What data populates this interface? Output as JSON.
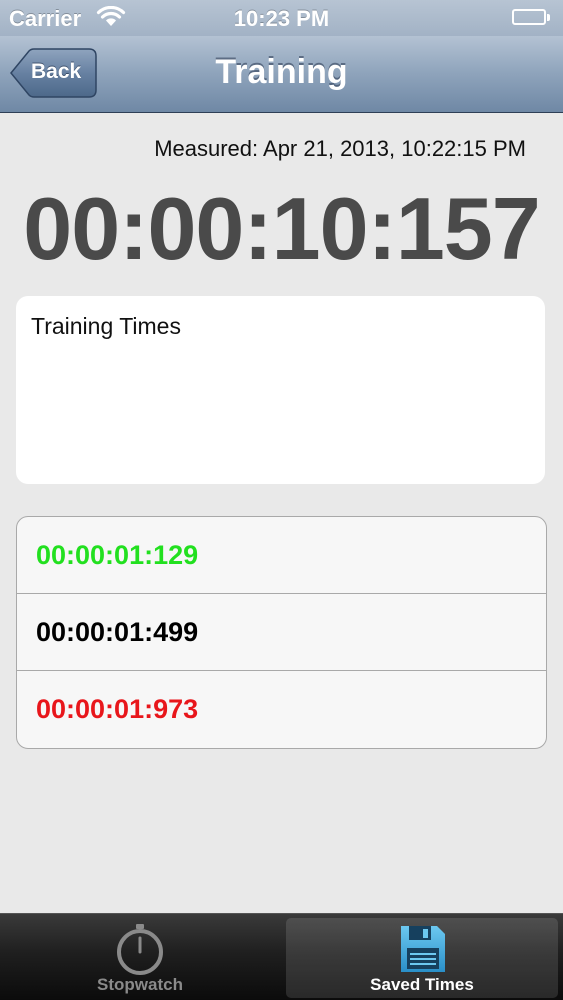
{
  "status_bar": {
    "carrier": "Carrier",
    "time": "10:23 PM",
    "battery_level": 1.0
  },
  "nav": {
    "back_label": "Back",
    "title": "Training"
  },
  "measured_label": "Measured: Apr 21, 2013, 10:22:15 PM",
  "total_time": "00:00:10:157",
  "notes": {
    "text": "Training Times"
  },
  "times": [
    {
      "value": "00:00:01:129",
      "color": "#22e01f"
    },
    {
      "value": "00:00:01:499",
      "color": "#000000"
    },
    {
      "value": "00:00:01:973",
      "color": "#e8161b"
    }
  ],
  "tabs": [
    {
      "label": "Stopwatch",
      "icon": "stopwatch-icon",
      "selected": false
    },
    {
      "label": "Saved Times",
      "icon": "floppy-disk-icon",
      "selected": true
    }
  ],
  "colors": {
    "selected_tab_icon": "#4fb6e8"
  }
}
